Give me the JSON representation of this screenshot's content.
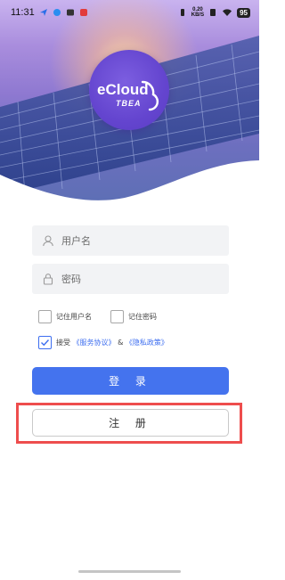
{
  "status_bar": {
    "time": "11:31",
    "net_speed_top": "0.20",
    "net_speed_bottom": "KB/S",
    "battery": "95"
  },
  "logo": {
    "brand_text": "eCloud",
    "company_text": "TBEA"
  },
  "form": {
    "username_placeholder": "用户名",
    "password_placeholder": "密码",
    "remember_username_label": "记住用户名",
    "remember_password_label": "记住密码",
    "agree_prefix": "接受",
    "service_agreement_link": "《服务协议》",
    "agree_ampersand": "&",
    "privacy_policy_link": "《隐私政策》",
    "agree_checked": true,
    "remember_username_checked": false,
    "remember_password_checked": false
  },
  "buttons": {
    "login_label": "登 录",
    "register_label": "注 册"
  },
  "colors": {
    "primary": "#4473ee",
    "highlight": "#ee4d4d",
    "logo": "#6445cf"
  },
  "icons": [
    "user-icon",
    "lock-icon",
    "checkmark-icon",
    "wifi-icon",
    "battery-icon"
  ]
}
